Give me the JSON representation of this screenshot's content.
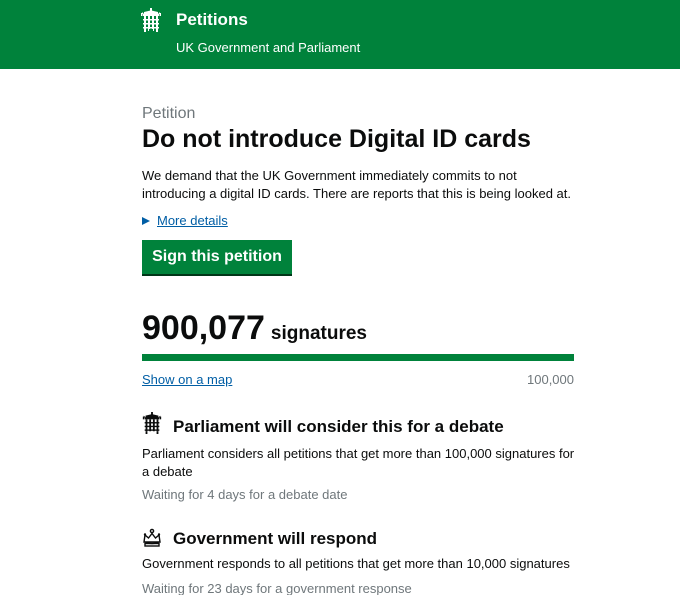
{
  "header": {
    "title": "Petitions",
    "subtitle": "UK Government and Parliament",
    "icon": "portcullis-icon",
    "color": "#00823b"
  },
  "petition": {
    "caption": "Petition",
    "title": "Do not introduce Digital ID cards",
    "summary": "We demand that the UK Government immediately commits to not introducing a digital ID cards. There are reports that this is being looked at.",
    "more_details_label": "More details",
    "sign_button_label": "Sign this petition"
  },
  "signatures": {
    "count": "900,077",
    "label": "signatures",
    "map_link_label": "Show on a map",
    "threshold": "100,000",
    "progress_fraction": 1.0
  },
  "debate": {
    "icon": "portcullis-icon",
    "title": "Parliament will consider this for a debate",
    "text": "Parliament considers all petitions that get more than 100,000 signatures for a debate",
    "status": "Waiting for 4 days for a debate date"
  },
  "response": {
    "icon": "crown-icon",
    "title": "Government will respond",
    "text": "Government responds to all petitions that get more than 10,000 signatures",
    "status": "Waiting for 23 days for a government response"
  },
  "colors": {
    "brand_green": "#00823b",
    "link_blue": "#005ea5",
    "secondary_text": "#6f777b"
  }
}
